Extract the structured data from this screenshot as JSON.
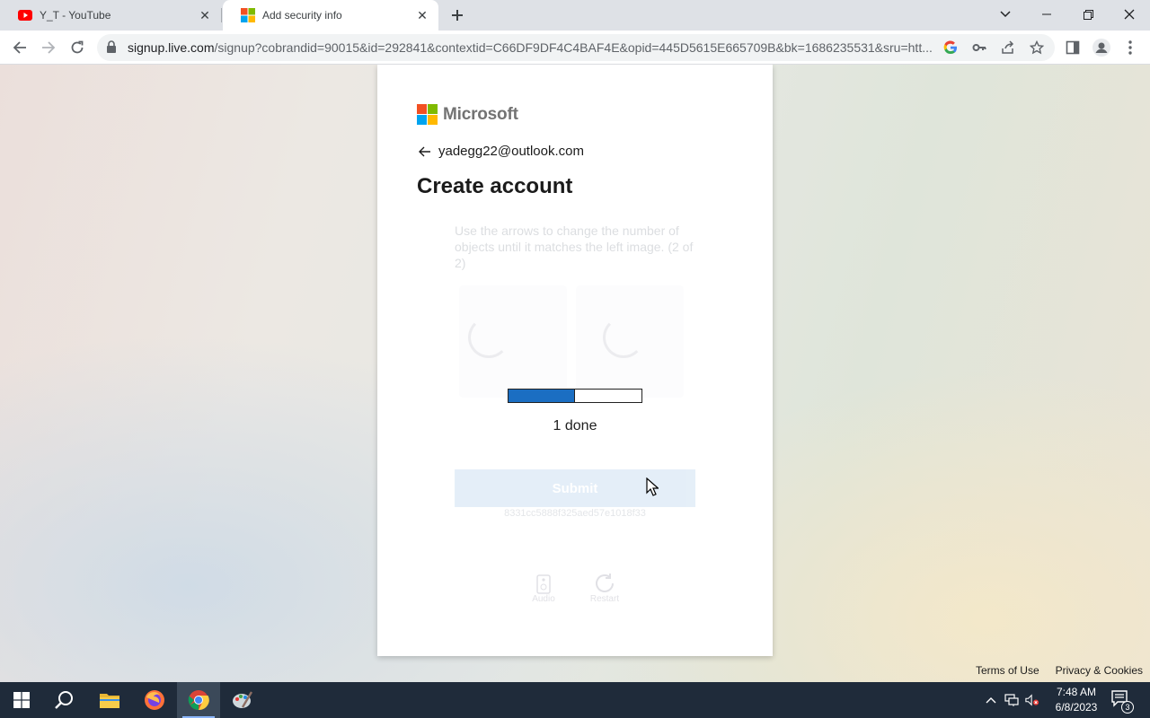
{
  "browser": {
    "tabs": [
      {
        "title": "Y_T - YouTube",
        "icon": "youtube-icon",
        "active": false
      },
      {
        "title": "Add security info",
        "icon": "microsoft-icon",
        "active": true
      }
    ],
    "url_host": "signup.live.com",
    "url_rest": "/signup?cobrandid=90015&id=292841&contextid=C66DF9DF4C4BAF4E&opid=445D5615E665709B&bk=1686235531&sru=htt..."
  },
  "card": {
    "brand": "Microsoft",
    "identity": "yadegg22@outlook.com",
    "title": "Create account",
    "puzzle_instruction": "Use the arrows to change the number of objects until it matches the left image. (2 of 2)",
    "submit_label": "Submit",
    "session_id": "8331cc5888f325aed57e1018f33",
    "audio_label": "Audio",
    "restart_label": "Restart",
    "progress": {
      "value": 0.5,
      "text": "1 done"
    }
  },
  "footer": {
    "terms": "Terms of Use",
    "privacy": "Privacy & Cookies"
  },
  "taskbar": {
    "time": "7:48 AM",
    "date": "6/8/2023",
    "notification_count": "3"
  },
  "colors": {
    "progress_fill": "#1b6ec2",
    "ms_red": "#f25022",
    "ms_green": "#7fba00",
    "ms_blue": "#00a4ef",
    "ms_yellow": "#ffb900",
    "taskbar_bg": "#1f2b3a"
  }
}
